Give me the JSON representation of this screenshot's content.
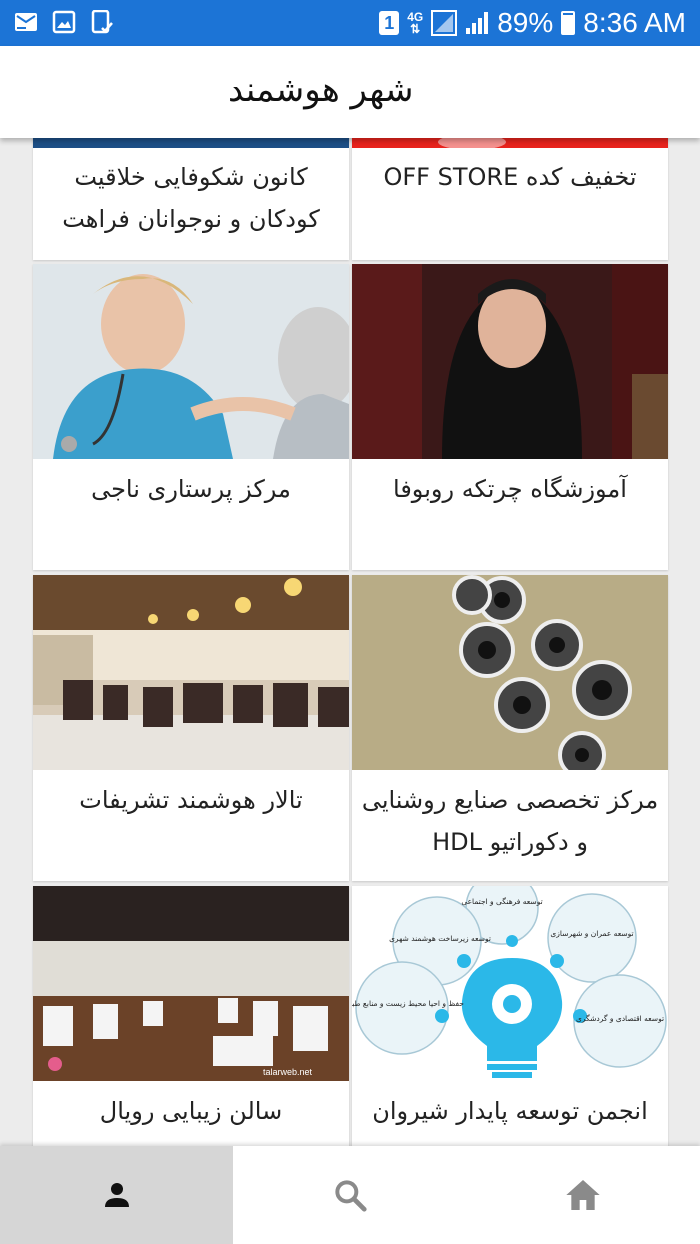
{
  "status_bar": {
    "left_icons": [
      "mail-warning-icon",
      "image-icon",
      "clipboard-check-icon"
    ],
    "sim_number": "1",
    "network_type": "4G",
    "battery": "89%",
    "battery_level": 0.89,
    "time": "8:36 AM"
  },
  "header": {
    "title": "شهر هوشمند"
  },
  "cards": [
    {
      "title": "کانون شکوفایی خلاقیت کودکان و نوجوانان فراهت"
    },
    {
      "title": "تخفیف کده OFF STORE"
    },
    {
      "title": "مرکز پرستاری ناجی"
    },
    {
      "title": "آموزشگاه چرتکه روبوفا"
    },
    {
      "title": "تالار هوشمند تشریفات"
    },
    {
      "title": "مرکز تخصصی صنایع روشنایی و دکوراتیو HDL"
    },
    {
      "title": "سالن زیبایی رویال"
    },
    {
      "title": "انجمن توسعه پایدار شیروان"
    }
  ],
  "infographic": {
    "bubbles": [
      "توسعه فرهنگی و اجتماعی",
      "توسعه زیرساخت هوشمند شهری",
      "توسعه عمران و شهرسازی",
      "حفظ و احیا محیط زیست و منابع طبیعی",
      "توسعه اقتصادی و گردشگری"
    ]
  },
  "watermark": "talarweb.net",
  "bottom_nav": {
    "items": [
      {
        "icon": "person-icon",
        "active": true
      },
      {
        "icon": "search-icon",
        "active": false
      },
      {
        "icon": "home-icon",
        "active": false
      }
    ]
  },
  "colors": {
    "status_bar": "#1c74d6",
    "active_tab": "#d6d6d6",
    "icon_gray": "#8a8a8a"
  }
}
